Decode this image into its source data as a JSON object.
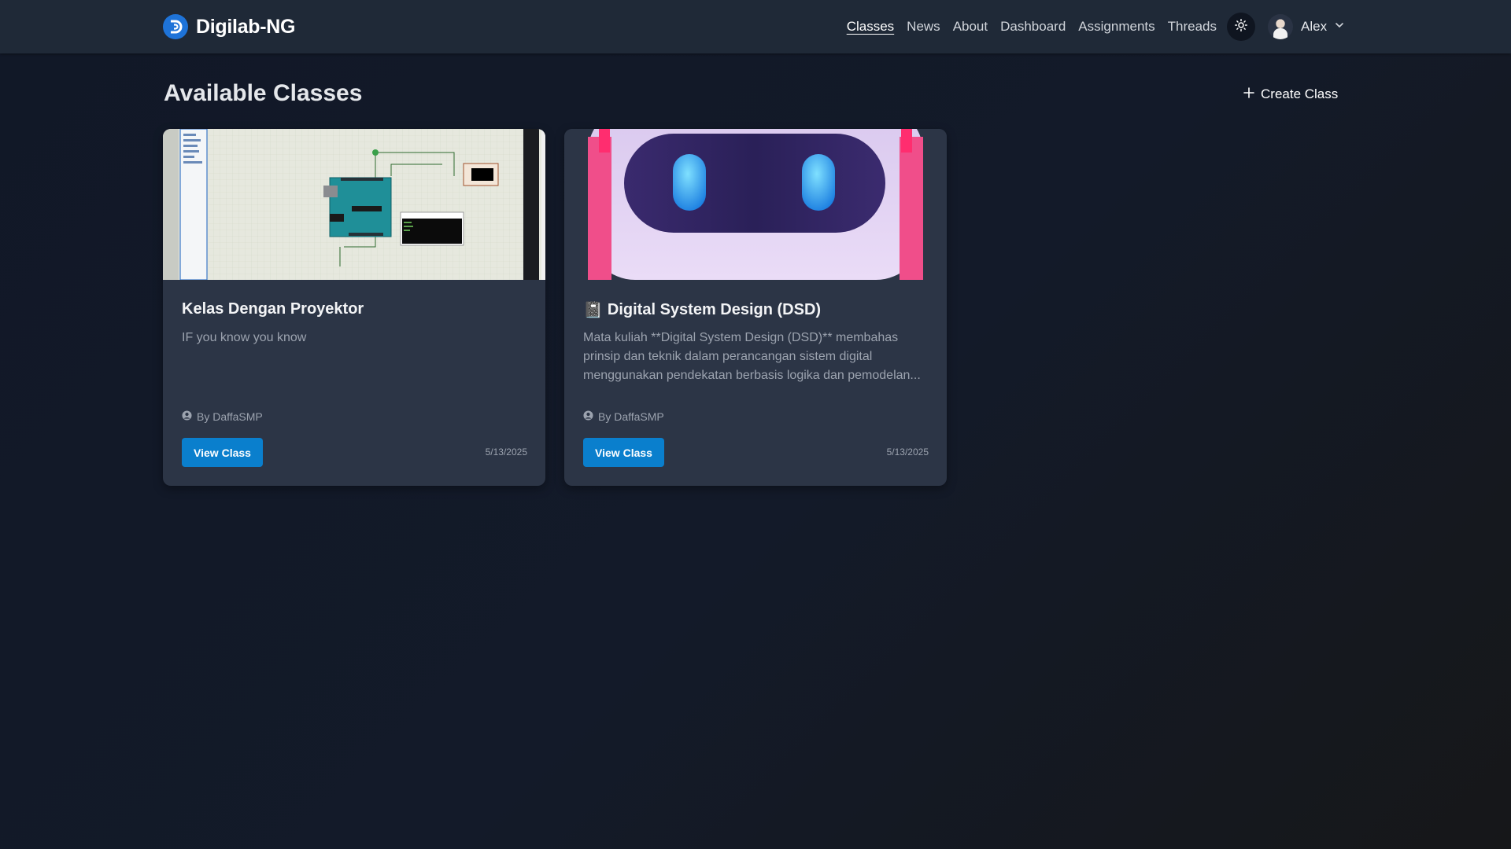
{
  "app": {
    "name": "Digilab-NG"
  },
  "nav": {
    "links": [
      "Classes",
      "News",
      "About",
      "Dashboard",
      "Assignments",
      "Threads"
    ],
    "active": "Classes"
  },
  "user": {
    "name": "Alex"
  },
  "page": {
    "title": "Available Classes",
    "create_label": "Create Class"
  },
  "classes": [
    {
      "title": "Kelas Dengan Proyektor",
      "description": "IF you know you know",
      "author": "By DaffaSMP",
      "button": "View Class",
      "date": "5/13/2025"
    },
    {
      "emoji": "📓",
      "title": "Digital System Design (DSD)",
      "description": "Mata kuliah **Digital System Design (DSD)** membahas prinsip dan teknik dalam perancangan sistem digital menggunakan pendekatan berbasis logika dan pemodelan...",
      "author": "By DaffaSMP",
      "button": "View Class",
      "date": "5/13/2025"
    }
  ],
  "colors": {
    "background": "#111827",
    "topbar": "#1f2937",
    "card": "#2c3546",
    "accent": "#0a7fcd",
    "logo": "#1e73d8"
  },
  "icons": {
    "logo": "logo-icon",
    "theme": "sun-icon",
    "user_menu": "chevron-down-icon",
    "create": "plus-icon",
    "author": "user-circle-icon"
  }
}
